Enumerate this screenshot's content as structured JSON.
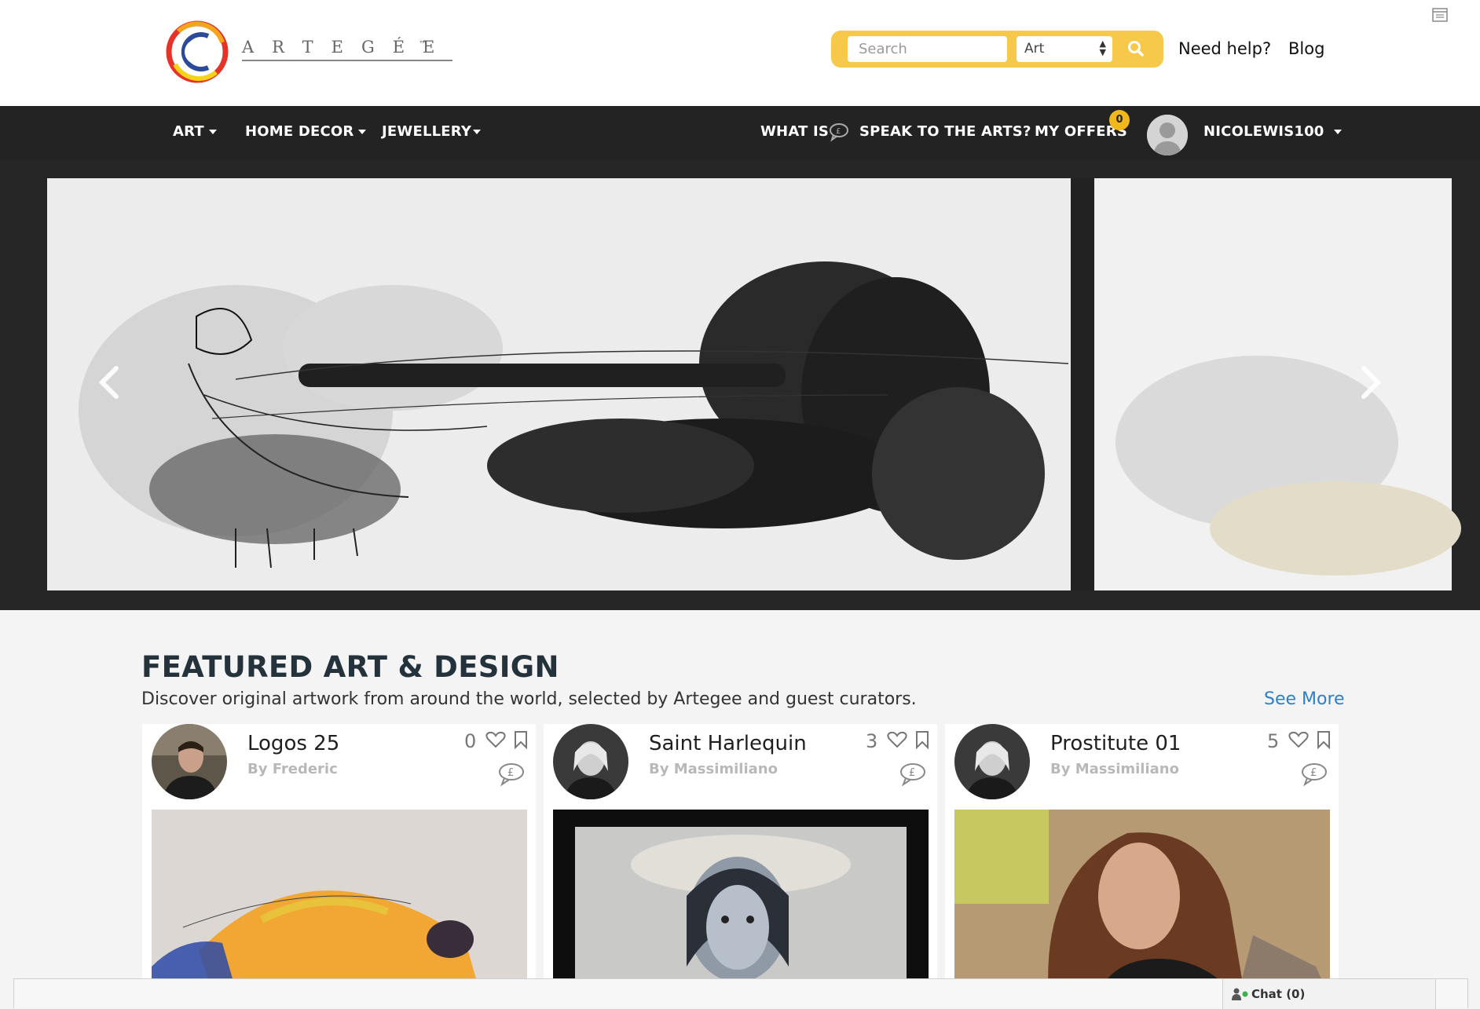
{
  "header": {
    "logo_text": "ARTEGÉE",
    "logo_tm": "™",
    "search_placeholder": "Search",
    "search_category": "Art",
    "need_help": "Need help?",
    "blog": "Blog"
  },
  "nav": {
    "art": "ART",
    "home_decor": "HOME DECOR",
    "jewellery": "JEWELLERY",
    "what_is": "WHAT IS",
    "speak": "SPEAK TO THE ARTS?",
    "my_offers": "MY OFFERS",
    "offers_count": "0",
    "username": "NICOLEWIS100"
  },
  "featured": {
    "title": "FEATURED ART & DESIGN",
    "subtitle": "Discover original artwork from around the world, selected by Artegee and guest curators.",
    "see_more": "See More",
    "cards": [
      {
        "title": "Logos 25",
        "artist": "By Frederic",
        "count": "0"
      },
      {
        "title": "Saint Harlequin",
        "artist": "By Massimiliano",
        "count": "3"
      },
      {
        "title": "Prostitute 01",
        "artist": "By Massimiliano",
        "count": "5"
      }
    ]
  },
  "chat": {
    "label": "Chat (0)"
  },
  "colors": {
    "accent_yellow": "#f7c94b",
    "nav_bg": "#232323",
    "link_blue": "#2e7fc4"
  }
}
